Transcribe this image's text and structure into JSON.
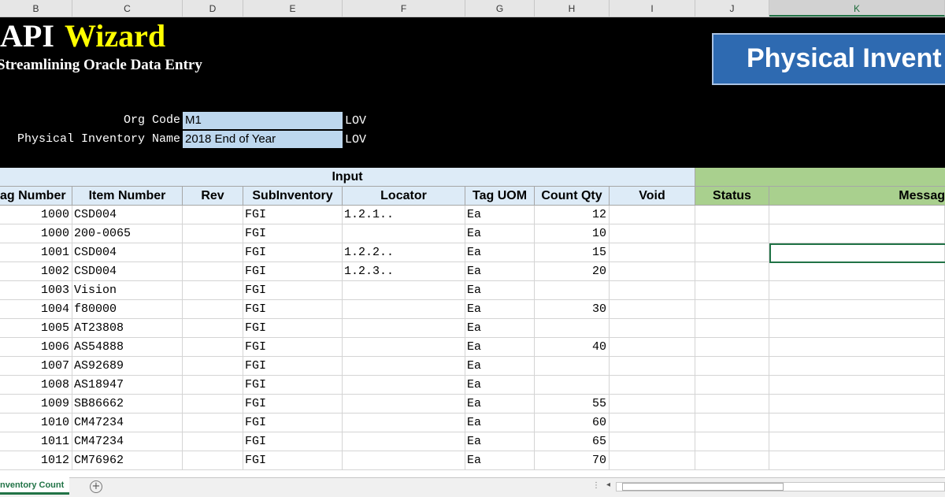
{
  "columns": [
    {
      "letter": "B"
    },
    {
      "letter": "C"
    },
    {
      "letter": "D"
    },
    {
      "letter": "E"
    },
    {
      "letter": "F"
    },
    {
      "letter": "G"
    },
    {
      "letter": "H"
    },
    {
      "letter": "I"
    },
    {
      "letter": "J"
    },
    {
      "letter": "K"
    }
  ],
  "banner": {
    "title_part1": "API",
    "title_part2": "Wizard",
    "subtitle": "Streamlining Oracle Data Entry",
    "button_label": "Physical Invent"
  },
  "params": {
    "org_code_label": "Org Code",
    "org_code_value": "M1",
    "pi_name_label": "Physical Inventory Name",
    "pi_name_value": "2018 End of Year",
    "lov_label": "LOV"
  },
  "groups": {
    "input": "Input"
  },
  "headers": {
    "tag_number": "ag Number",
    "item_number": "Item Number",
    "rev": "Rev",
    "subinventory": "SubInventory",
    "locator": "Locator",
    "tag_uom": "Tag UOM",
    "count_qty": "Count Qty",
    "void": "Void",
    "status": "Status",
    "message": "Messag"
  },
  "rows": [
    {
      "tag": "1000",
      "item": "CSD004",
      "rev": "",
      "sub": "FGI",
      "loc": "1.2.1..",
      "uom": "Ea",
      "qty": "12"
    },
    {
      "tag": "1000",
      "item": "200-0065",
      "rev": "",
      "sub": "FGI",
      "loc": "",
      "uom": "Ea",
      "qty": "10"
    },
    {
      "tag": "1001",
      "item": "CSD004",
      "rev": "",
      "sub": "FGI",
      "loc": "1.2.2..",
      "uom": "Ea",
      "qty": "15"
    },
    {
      "tag": "1002",
      "item": "CSD004",
      "rev": "",
      "sub": "FGI",
      "loc": "1.2.3..",
      "uom": "Ea",
      "qty": "20"
    },
    {
      "tag": "1003",
      "item": "Vision",
      "rev": "",
      "sub": "FGI",
      "loc": "",
      "uom": "Ea",
      "qty": ""
    },
    {
      "tag": "1004",
      "item": "f80000",
      "rev": "",
      "sub": "FGI",
      "loc": "",
      "uom": "Ea",
      "qty": "30"
    },
    {
      "tag": "1005",
      "item": "AT23808",
      "rev": "",
      "sub": "FGI",
      "loc": "",
      "uom": "Ea",
      "qty": ""
    },
    {
      "tag": "1006",
      "item": "AS54888",
      "rev": "",
      "sub": "FGI",
      "loc": "",
      "uom": "Ea",
      "qty": "40"
    },
    {
      "tag": "1007",
      "item": "AS92689",
      "rev": "",
      "sub": "FGI",
      "loc": "",
      "uom": "Ea",
      "qty": ""
    },
    {
      "tag": "1008",
      "item": "AS18947",
      "rev": "",
      "sub": "FGI",
      "loc": "",
      "uom": "Ea",
      "qty": ""
    },
    {
      "tag": "1009",
      "item": "SB86662",
      "rev": "",
      "sub": "FGI",
      "loc": "",
      "uom": "Ea",
      "qty": "55"
    },
    {
      "tag": "1010",
      "item": "CM47234",
      "rev": "",
      "sub": "FGI",
      "loc": "",
      "uom": "Ea",
      "qty": "60"
    },
    {
      "tag": "1011",
      "item": "CM47234",
      "rev": "",
      "sub": "FGI",
      "loc": "",
      "uom": "Ea",
      "qty": "65"
    },
    {
      "tag": "1012",
      "item": "CM76962",
      "rev": "",
      "sub": "FGI",
      "loc": "",
      "uom": "Ea",
      "qty": "70"
    }
  ],
  "sheet_tab": "nventory Count",
  "add_sheet_icon": "plus-circle-icon",
  "colors": {
    "banner_bg": "#000000",
    "wizard_yellow": "#ffff00",
    "input_header_bg": "#ddebf7",
    "output_header_bg": "#a9d08e",
    "param_value_bg": "#bdd7ee",
    "button_bg": "#2e6ab1",
    "excel_green": "#217346"
  }
}
